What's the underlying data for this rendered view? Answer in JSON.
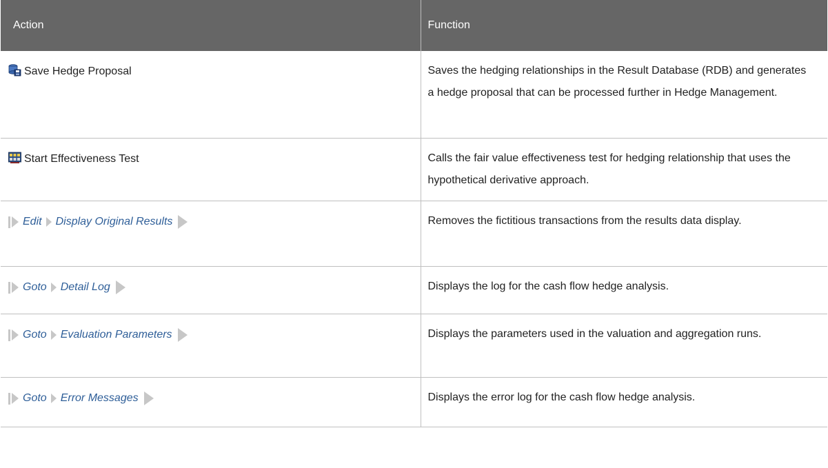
{
  "header": {
    "col_action": "Action",
    "col_function": "Function"
  },
  "rows": [
    {
      "action": "Save Hedge Proposal",
      "icon": "save-database-icon",
      "function": "Saves the hedging relationships in the Result Database (RDB) and generates a hedge proposal that can be processed further in Hedge Management."
    },
    {
      "action": "Start Effectiveness Test",
      "icon": "effectiveness-test-icon",
      "function": "Calls the fair value effectiveness test for hedging relationship that uses the hypothetical derivative approach."
    },
    {
      "menu": "Edit",
      "item": "Display Original Results",
      "function": "Removes the fictitious transactions from the results data display."
    },
    {
      "menu": "Goto",
      "item": "Detail Log",
      "function": "Displays the log for the cash flow hedge analysis."
    },
    {
      "menu": "Goto",
      "item": "Evaluation Parameters",
      "function": "Displays the parameters used in the valuation and aggregation runs."
    },
    {
      "menu": "Goto",
      "item": "Error Messages",
      "function": "Displays the error log for the cash flow hedge analysis."
    }
  ],
  "colors": {
    "header_bg": "#666666",
    "link": "#2e5e98",
    "arrow": "#c7c7c7",
    "border": "#bfbfbf"
  }
}
